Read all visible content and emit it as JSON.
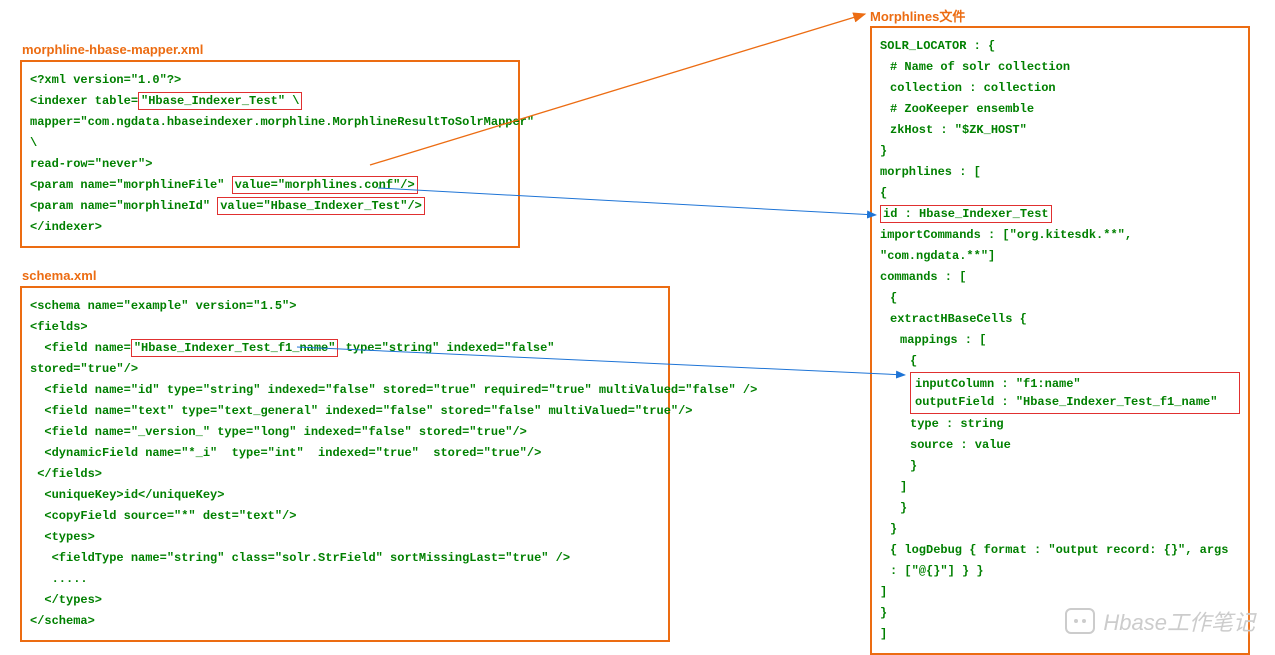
{
  "titles": {
    "mapper": "morphline-hbase-mapper.xml",
    "schema": "schema.xml",
    "morphlines": "Morphlines文件"
  },
  "mapper": {
    "l1a": "<?xml version=\"1.0\"?>",
    "l2a": "<indexer table=",
    "l2hl": "\"Hbase_Indexer_Test\"  \\",
    "l3": "mapper=\"com.ngdata.hbaseindexer.morphline.MorphlineResultToSolrMapper\" \\",
    "l4": "read-row=\"never\">",
    "l5a": "<param name=\"morphlineFile\" ",
    "l5hl": "value=\"morphlines.conf\"/>",
    "l6a": "<param name=\"morphlineId\" ",
    "l6hl": "value=\"Hbase_Indexer_Test\"/>",
    "l7": "</indexer>"
  },
  "schema": {
    "s1": "<schema name=\"example\" version=\"1.5\">",
    "s2": " <fields>",
    "s3a": "  <field name=",
    "s3hl": "\"Hbase_Indexer_Test_f1_name\"",
    "s3b": " type=\"string\" indexed=\"false\" stored=\"true\"/>",
    "s4": "  <field name=\"id\" type=\"string\" indexed=\"false\" stored=\"true\" required=\"true\" multiValued=\"false\" />",
    "s5": "  <field name=\"text\" type=\"text_general\" indexed=\"false\" stored=\"false\" multiValued=\"true\"/>",
    "s6": "  <field name=\"_version_\" type=\"long\" indexed=\"false\" stored=\"true\"/>",
    "s7": "  <dynamicField name=\"*_i\"  type=\"int\"  indexed=\"true\"  stored=\"true\"/>",
    "s8": " </fields>",
    "s9": "  <uniqueKey>id</uniqueKey>",
    "s10": "  <copyField source=\"*\" dest=\"text\"/>",
    "s11": "  <types>",
    "s12": "   <fieldType name=\"string\" class=\"solr.StrField\" sortMissingLast=\"true\" />",
    "s13": "   .....",
    "s14": "  </types>",
    "s15": "</schema>"
  },
  "morph": {
    "m1": "SOLR_LOCATOR : {",
    "m2": "# Name of solr collection",
    "m3": "collection : collection",
    "m4": "# ZooKeeper ensemble",
    "m5": "zkHost : \"$ZK_HOST\"",
    "m6": "}",
    "m7": "morphlines : [",
    "m8": "{",
    "m9hl": "id : Hbase_Indexer_Test",
    "m10": "importCommands : [\"org.kitesdk.**\", \"com.ngdata.**\"]",
    "m11": "commands : [",
    "m12": "{",
    "m13": "extractHBaseCells {",
    "m14": "mappings : [",
    "m15": "{",
    "m16hl1": "inputColumn : \"f1:name\"",
    "m16hl2": "outputField : \"Hbase_Indexer_Test_f1_name\"",
    "m17": "type : string",
    "m18": "source : value",
    "m19": "}",
    "m20": "]",
    "m21": "}",
    "m22": "}",
    "m23": "{ logDebug { format : \"output record: {}\", args : [\"@{}\"] } }",
    "m24": "]",
    "m25": "}",
    "m26": "]"
  },
  "watermark": "Hbase工作笔记"
}
